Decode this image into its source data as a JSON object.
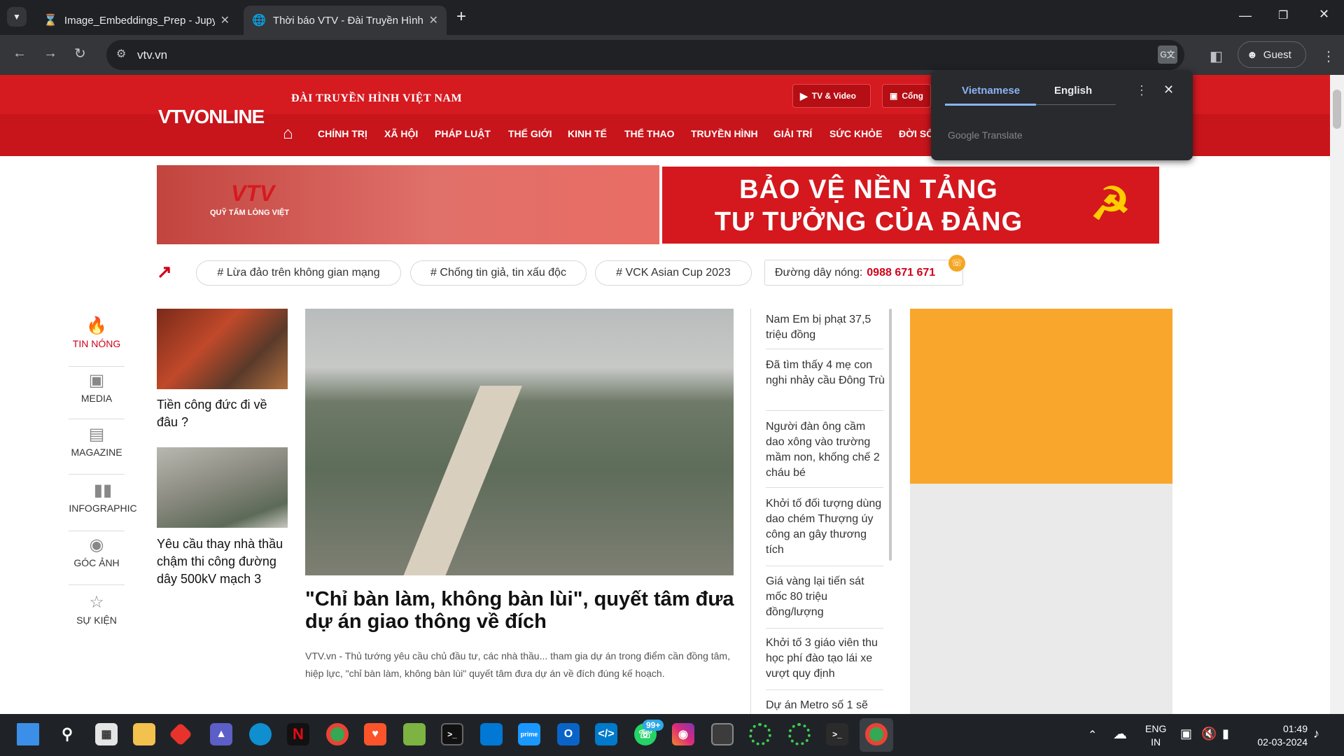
{
  "browser": {
    "tabs": [
      {
        "title": "Image_Embeddings_Prep - Jupy",
        "icon": "hourglass-icon"
      },
      {
        "title": "Thời báo VTV - Đài Truyền Hình",
        "icon": "globe-icon"
      }
    ],
    "url": "vtv.vn",
    "profile": "Guest"
  },
  "header": {
    "logo": "VTVONLINE",
    "tagline": "ĐÀI TRUYỀN HÌNH VIỆT NAM",
    "tv_video": "TV & Video",
    "cong": "Cổng",
    "nav": [
      "CHÍNH TRỊ",
      "XÃ HỘI",
      "PHÁP LUẬT",
      "THẾ GIỚI",
      "KINH TẾ",
      "THỂ THAO",
      "TRUYỀN HÌNH",
      "GIẢI TRÍ",
      "SỨC KHỎE",
      "ĐỜI SỐ"
    ]
  },
  "banners": {
    "left_sub": "QUỸ TẤM LÒNG VIỆT",
    "left_logo": "VTV",
    "right_line1": "BẢO VỆ NỀN TẢNG",
    "right_line2": "TƯ TƯỞNG CỦA ĐẢNG"
  },
  "tags": [
    "# Lừa đảo trên không gian mạng",
    "# Chống tin giả, tin xấu độc",
    "# VCK Asian Cup 2023"
  ],
  "hotline": {
    "label": "Đường dây nóng:",
    "number": "0988 671 671"
  },
  "rail": [
    {
      "label": "TIN NÓNG",
      "icon": "flame-icon"
    },
    {
      "label": "MEDIA",
      "icon": "media-icon"
    },
    {
      "label": "MAGAZINE",
      "icon": "magazine-icon"
    },
    {
      "label": "INFOGRAPHIC",
      "icon": "infographic-icon"
    },
    {
      "label": "GÓC ẢNH",
      "icon": "camera-icon"
    },
    {
      "label": "SỰ KIỆN",
      "icon": "star-icon"
    }
  ],
  "small_articles": [
    {
      "title": "Tiền công đức đi về đâu ?"
    },
    {
      "title": "Yêu cầu thay nhà thầu chậm thi công đường dây 500kV mạch 3"
    }
  ],
  "main_article": {
    "title": "\"Chỉ bàn làm, không bàn lùi\", quyết tâm đưa dự án giao thông về đích",
    "summary": "VTV.vn - Thủ tướng yêu cầu chủ đầu tư, các nhà thầu... tham gia dự án trong điểm cần đồng tâm, hiệp lực, \"chỉ bàn làm, không bàn lùi\" quyết tâm đưa dự án về đích đúng kế hoạch."
  },
  "right_list": [
    "Nam Em bị phạt 37,5 triệu đồng",
    "Đã tìm thấy 4 mẹ con nghi nhảy cầu Đông Trù",
    "Người đàn ông cầm dao xông vào trường mầm non, khống chế 2 cháu bé",
    "Khởi tố đối tượng dùng dao chém Thượng úy công an gây thương tích",
    "Giá vàng lại tiến sát mốc 80 triệu đồng/lượng",
    "Khởi tố 3 giáo viên thu học phí đào tạo lái xe vượt quy định",
    "Dự án Metro số 1 sẽ"
  ],
  "translate_popup": {
    "tab_active": "Vietnamese",
    "tab_other": "English",
    "brand": "Google Translate"
  },
  "taskbar": {
    "lang": "ENG",
    "region": "IN",
    "time": "01:49",
    "date": "02-03-2024",
    "badge": "99+"
  }
}
